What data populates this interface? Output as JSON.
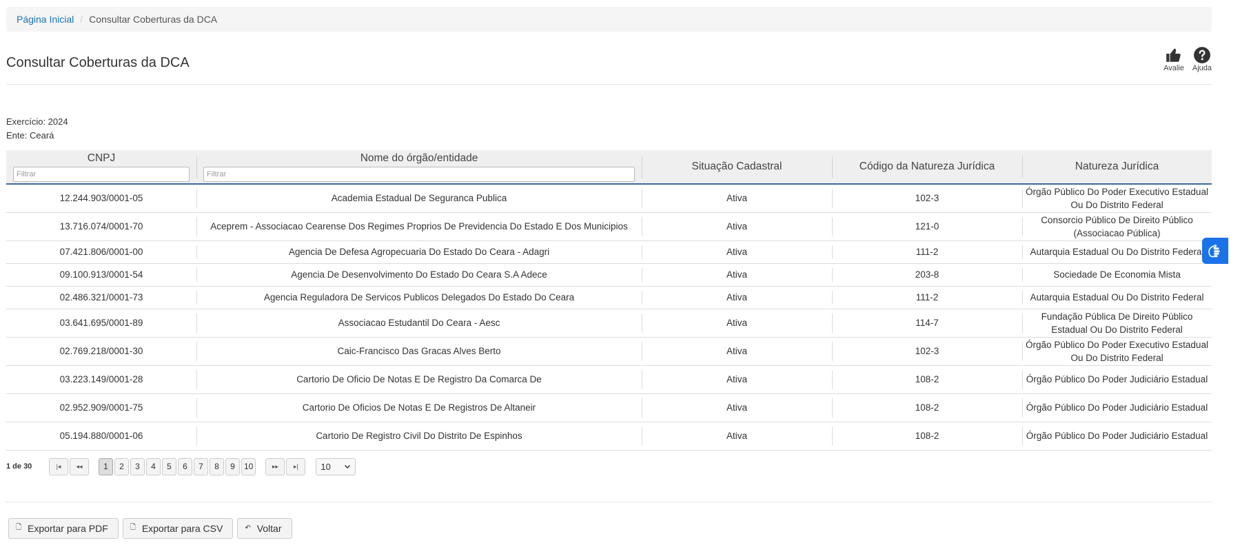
{
  "breadcrumb": {
    "home": "Página Inicial",
    "current": "Consultar Coberturas da DCA"
  },
  "page_title": "Consultar Coberturas da DCA",
  "header_actions": {
    "rate_label": "Avalie",
    "help_label": "Ajuda"
  },
  "info": {
    "exercicio": "Exercício: 2024",
    "ente": "Ente: Ceará"
  },
  "table": {
    "columns": {
      "cnpj": "CNPJ",
      "nome": "Nome do órgão/entidade",
      "situacao": "Situação Cadastral",
      "codigo": "Código da Natureza Jurídica",
      "natureza": "Natureza Jurídica"
    },
    "filter_placeholder": "Filtrar",
    "rows": [
      {
        "cnpj": "12.244.903/0001-05",
        "nome": "Academia Estadual De Seguranca Publica",
        "situacao": "Ativa",
        "codigo": "102-3",
        "natureza": "Órgão Público Do Poder Executivo Estadual Ou Do Distrito Federal"
      },
      {
        "cnpj": "13.716.074/0001-70",
        "nome": "Aceprem - Associacao Cearense Dos Regimes Proprios De Previdencia Do Estado E Dos Municipios",
        "situacao": "Ativa",
        "codigo": "121-0",
        "natureza": "Consorcio Público De Direito Público (Associacao Pública)"
      },
      {
        "cnpj": "07.421.806/0001-00",
        "nome": "Agencia De Defesa Agropecuaria Do Estado Do Ceara - Adagri",
        "situacao": "Ativa",
        "codigo": "111-2",
        "natureza": "Autarquia Estadual Ou Do Distrito Federal"
      },
      {
        "cnpj": "09.100.913/0001-54",
        "nome": "Agencia De Desenvolvimento Do Estado Do Ceara S.A Adece",
        "situacao": "Ativa",
        "codigo": "203-8",
        "natureza": "Sociedade De Economia Mista"
      },
      {
        "cnpj": "02.486.321/0001-73",
        "nome": "Agencia Reguladora De Servicos Publicos Delegados Do Estado Do Ceara",
        "situacao": "Ativa",
        "codigo": "111-2",
        "natureza": "Autarquia Estadual Ou Do Distrito Federal"
      },
      {
        "cnpj": "03.641.695/0001-89",
        "nome": "Associacao Estudantil Do Ceara - Aesc",
        "situacao": "Ativa",
        "codigo": "114-7",
        "natureza": "Fundação Pública De Direito Público Estadual Ou Do Distrito Federal"
      },
      {
        "cnpj": "02.769.218/0001-30",
        "nome": "Caic-Francisco Das Gracas Alves Berto",
        "situacao": "Ativa",
        "codigo": "102-3",
        "natureza": "Órgão Público Do Poder Executivo Estadual Ou Do Distrito Federal"
      },
      {
        "cnpj": "03.223.149/0001-28",
        "nome": "Cartorio De Oficio De Notas E De Registro Da Comarca De",
        "situacao": "Ativa",
        "codigo": "108-2",
        "natureza": "Órgão Público Do Poder Judiciário Estadual"
      },
      {
        "cnpj": "02.952.909/0001-75",
        "nome": "Cartorio De Oficios De Notas E De Registros De Altaneir",
        "situacao": "Ativa",
        "codigo": "108-2",
        "natureza": "Órgão Público Do Poder Judiciário Estadual"
      },
      {
        "cnpj": "05.194.880/0001-06",
        "nome": "Cartorio De Registro Civil Do Distrito De Espinhos",
        "situacao": "Ativa",
        "codigo": "108-2",
        "natureza": "Órgão Público Do Poder Judiciário Estadual"
      }
    ]
  },
  "pagination": {
    "info": "1 de 30",
    "first": "|◂",
    "prev": "◂◂",
    "next": "▸▸",
    "last": "▸|",
    "pages": [
      "1",
      "2",
      "3",
      "4",
      "5",
      "6",
      "7",
      "8",
      "9",
      "10"
    ],
    "current_page": "1",
    "page_size": "10"
  },
  "actions": {
    "pdf": "Exportar para PDF",
    "csv": "Exportar para CSV",
    "back": "Voltar"
  },
  "icons": {
    "rate": "thumbs-up-icon",
    "help": "question-circle-icon",
    "export": "file-icon",
    "back": "undo-arrow-icon",
    "accessibility": "sign-language-hands-icon"
  },
  "colors": {
    "link": "#1a73b5",
    "header_border": "#3b6aa0",
    "vlibras": "#1a73e8"
  }
}
